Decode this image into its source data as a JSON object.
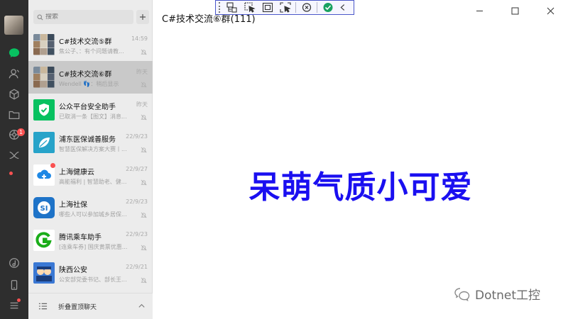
{
  "search": {
    "placeholder": "搜索"
  },
  "chats": [
    {
      "name": "C#技术交流⑤群",
      "time": "14:59",
      "preview": "焦公子、：有个问题请教...",
      "muted": true,
      "selected": false,
      "avatar": "group-grid-avatar-a"
    },
    {
      "name": "C#技术交流⑥群",
      "time": "昨天",
      "preview": "Wendell 👣：稍后显示",
      "muted": true,
      "selected": true,
      "avatar": "group-grid-avatar-b"
    },
    {
      "name": "公众平台安全助手",
      "time": "昨天",
      "preview": "已取消一条【图文】消息...",
      "muted": true,
      "selected": false,
      "avatar": "shield-check-avatar"
    },
    {
      "name": "浦东医保诚善服务",
      "time": "22/9/23",
      "preview": "智慧医保解决方案大赛丨...",
      "muted": true,
      "selected": false,
      "avatar": "leaf-avatar"
    },
    {
      "name": "上海健康云",
      "time": "22/9/27",
      "preview": "高能福利 | 智慧助老、健...",
      "muted": true,
      "selected": false,
      "unread_dot": true,
      "avatar": "cloud-avatar"
    },
    {
      "name": "上海社保",
      "time": "22/9/23",
      "preview": "哪些人可以参加城乡居保...",
      "muted": true,
      "selected": false,
      "avatar": "si-avatar"
    },
    {
      "name": "腾讯乘车助手",
      "time": "22/9/23",
      "preview": "[连乘车券] 国庆黄票优惠...",
      "muted": true,
      "selected": false,
      "avatar": "g-logo-avatar"
    },
    {
      "name": "陕西公安",
      "time": "22/9/21",
      "preview": "公安部党委书记、部长王...",
      "muted": true,
      "selected": false,
      "avatar": "police-avatar"
    }
  ],
  "fold_bar": {
    "label": "折叠置顶聊天"
  },
  "main": {
    "title": "C#技术交流⑥群(111)",
    "banner": "呆萌气质小可爱",
    "watermark": "Dotnet工控"
  },
  "rail_badge": "1",
  "colors": {
    "rail": "#2e2e2e",
    "accent_green": "#07c160",
    "badge_red": "#fa5151",
    "banner_blue": "#1a0ff0",
    "toolbar_border": "#4a57c9"
  },
  "icons": {
    "rail": [
      "chat-icon",
      "contacts-icon",
      "cube-icon",
      "folder-icon",
      "moments-icon",
      "mini-program-icon",
      "music-icon",
      "phone-icon",
      "menu-icon"
    ],
    "toolbar": [
      "live-visual-tree-icon",
      "select-element-icon",
      "display-adorners-icon",
      "track-focus-icon",
      "hot-reload-icon",
      "binding-check-icon",
      "collapse-icon"
    ],
    "window": [
      "minimize-icon",
      "maximize-icon",
      "close-icon"
    ]
  }
}
